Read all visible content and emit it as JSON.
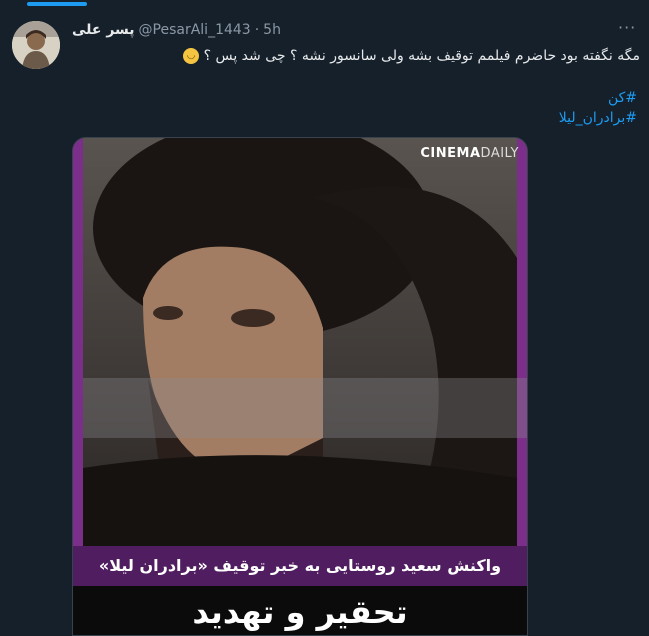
{
  "tweet": {
    "display_name": "پسر علی",
    "handle": "@PesarAli_1443",
    "separator": "·",
    "time": "5h",
    "more_label": "···",
    "text": "مگه نگفته بود حاضرم فیلمم توقیف بشه ولی سانسور نشه ؟ چی شد پس ؟",
    "emoji": "grinning-face",
    "hashtags": [
      "#کن",
      "#برادران_لیلا"
    ]
  },
  "media": {
    "brand_bold": "CINEMA",
    "brand_thin": "DAILY",
    "caption": "واکنش سعید روستایی به خبر توقیف «برادران لیلا»",
    "headline": "تحقیر و تهدید"
  },
  "colors": {
    "background": "#15202b",
    "accent": "#1d9bf0",
    "card_purple": "#7b2f8a"
  }
}
